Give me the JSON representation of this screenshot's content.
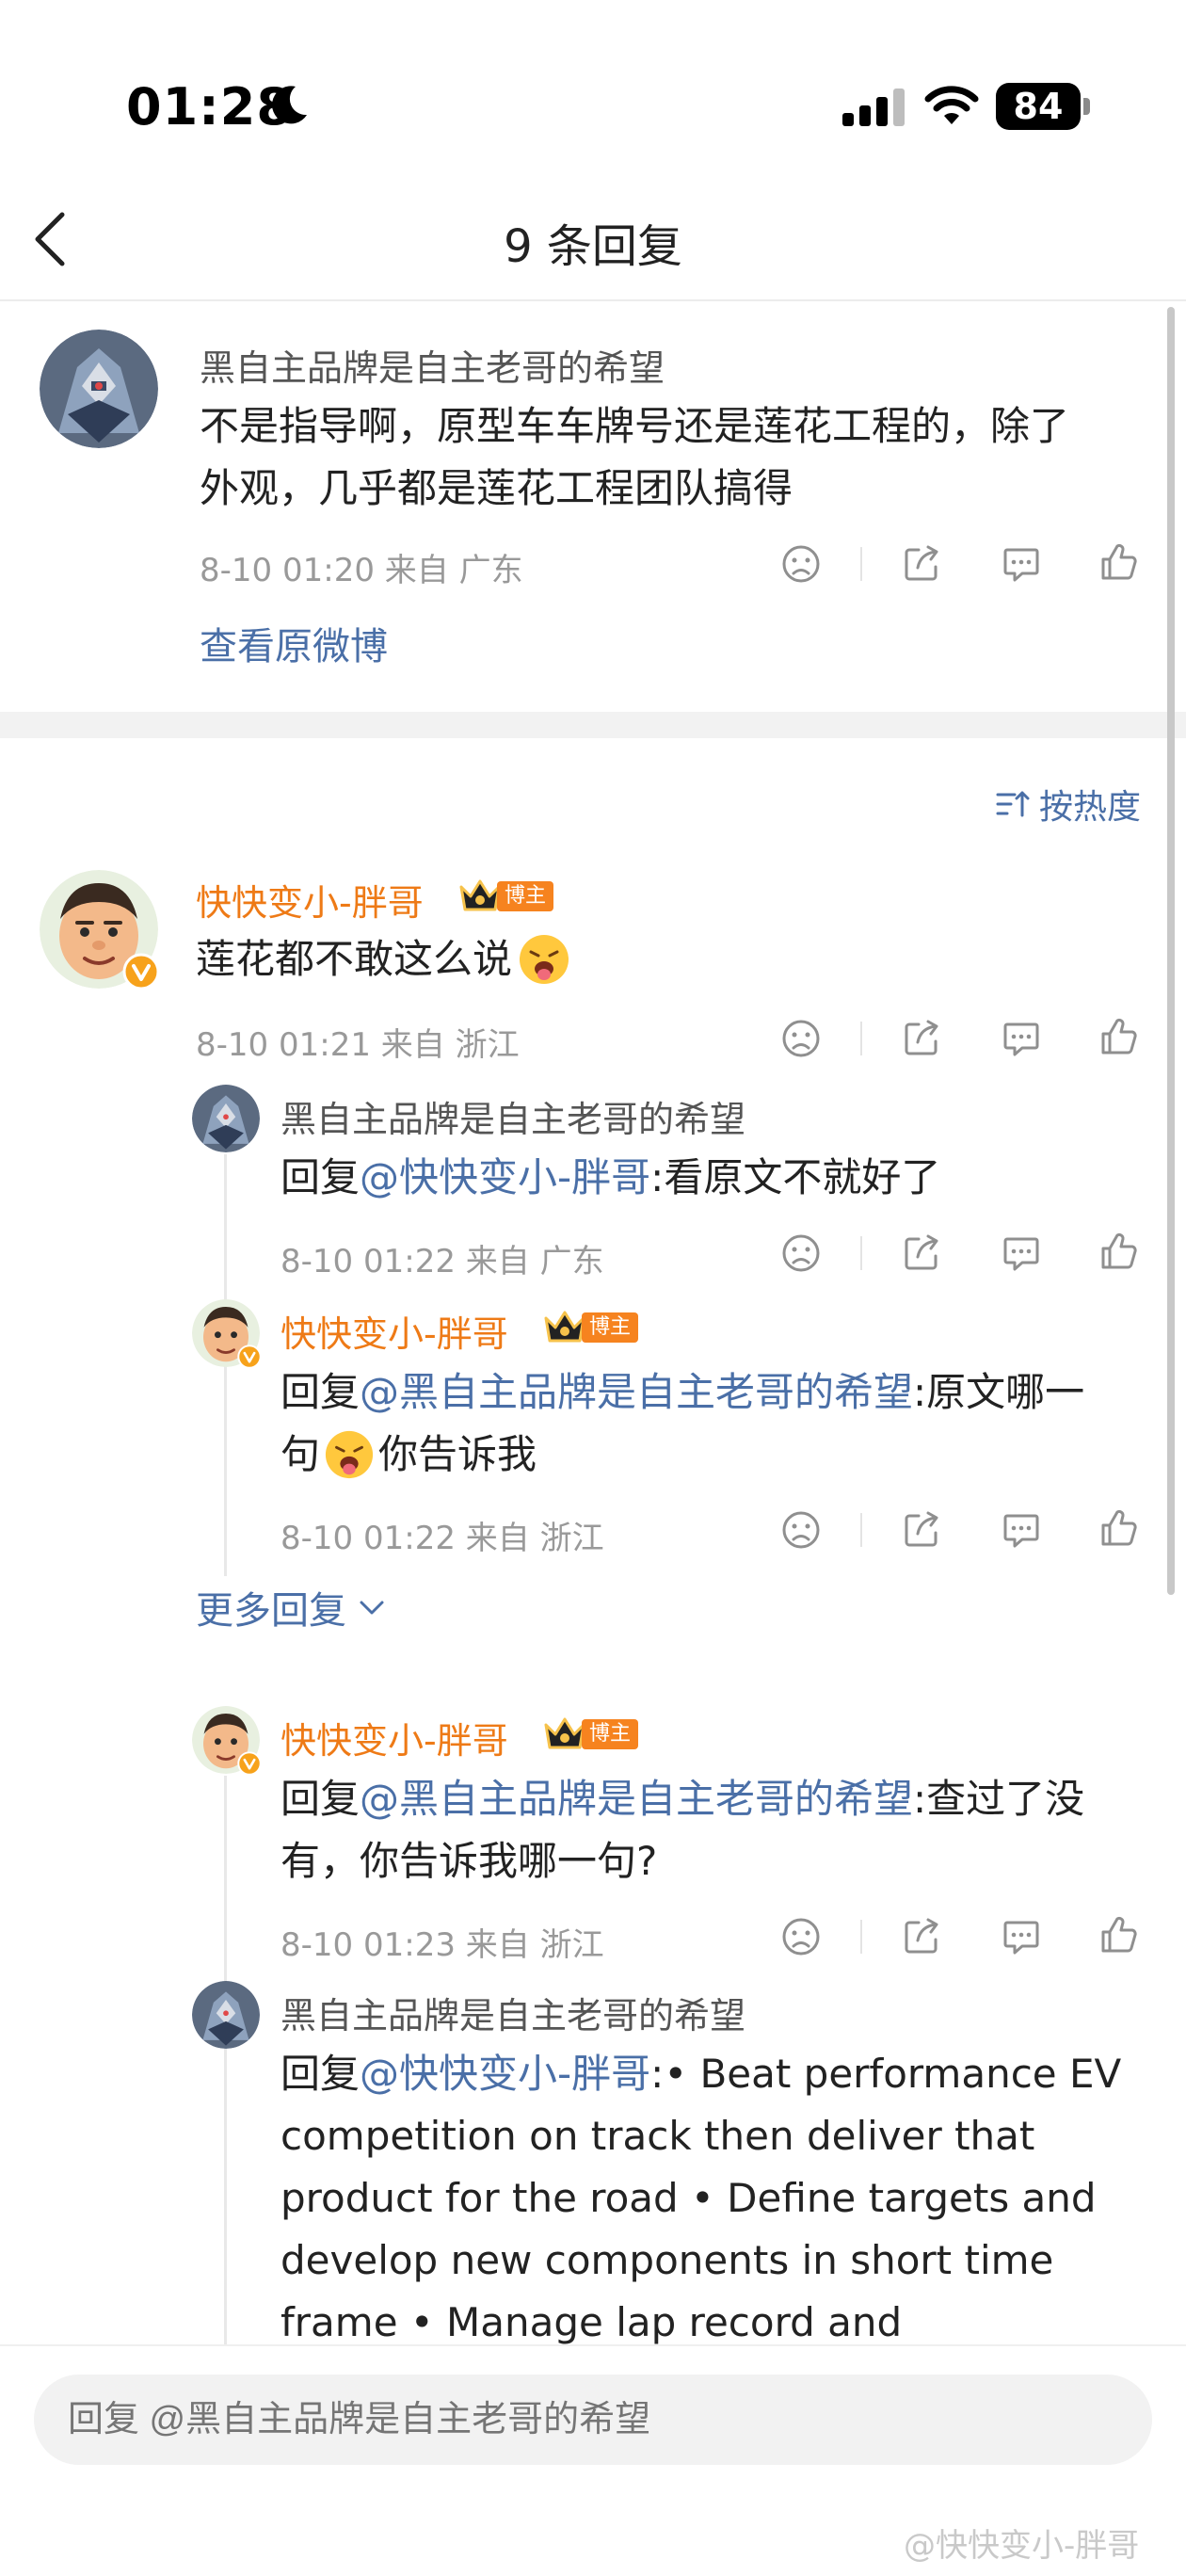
{
  "status_bar": {
    "time": "01:28",
    "battery": "84"
  },
  "header": {
    "title": "9 条回复"
  },
  "original_comment": {
    "author": "黑自主品牌是自主老哥的希望",
    "text_line1": "不是指导啊，原型车车牌号还是莲花工程的，除了",
    "text_line2": "外观，几乎都是莲花工程团队搞得",
    "meta": "8-10 01:20 来自 广东",
    "view_original": "查看原微博"
  },
  "sort": {
    "label": "按热度"
  },
  "main_comment": {
    "author": "快快变小-胖哥",
    "badge": "博主",
    "text": "莲花都不敢这么说",
    "meta": "8-10 01:21 来自 浙江"
  },
  "replies": [
    {
      "author": "黑自主品牌是自主老哥的希望",
      "prefix": "回复",
      "mention": "@快快变小-胖哥",
      "text": ":看原文不就好了",
      "meta": "8-10 01:22 来自 广东"
    },
    {
      "author": "快快变小-胖哥",
      "badge": "博主",
      "prefix": "回复",
      "mention": "@黑自主品牌是自主老哥的希望",
      "text": ":原文哪一",
      "text2a": "句",
      "text2b": "你告诉我",
      "meta": "8-10 01:22 来自 浙江"
    }
  ],
  "more_replies": "更多回复",
  "replies2": [
    {
      "author": "快快变小-胖哥",
      "badge": "博主",
      "prefix": "回复",
      "mention": "@黑自主品牌是自主老哥的希望",
      "text": ":查过了没",
      "text_line2": "有，你告诉我哪一句?",
      "meta": "8-10 01:23 来自 浙江"
    },
    {
      "author": "黑自主品牌是自主老哥的希望",
      "prefix": "回复",
      "mention": "@快快变小-胖哥",
      "text": ":• Beat performance EV",
      "line2": "competition on track then deliver that",
      "line3": "product for the road • Define targets and",
      "line4": "develop new components in short time",
      "line5": "frame • Manage lap record and"
    }
  ],
  "input": {
    "placeholder": "回复 @黑自主品牌是自主老哥的希望"
  },
  "watermark": "@快快变小-胖哥",
  "colors": {
    "accent_blue": "#4a6fa7",
    "author_orange": "#ee7a16",
    "badge_orange": "#f6831f"
  }
}
